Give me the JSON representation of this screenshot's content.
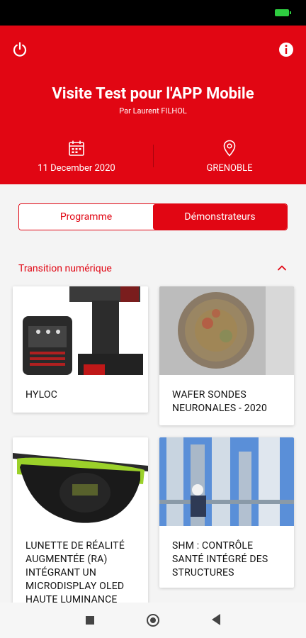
{
  "header": {
    "title": "Visite Test pour l'APP Mobile",
    "subtitle": "Par Laurent FILHOL",
    "date": "11 December 2020",
    "location": "GRENOBLE",
    "accent_color": "#e10613"
  },
  "tabs": [
    {
      "label": "Programme",
      "active": false
    },
    {
      "label": "Démonstrateurs",
      "active": true
    }
  ],
  "section": {
    "title": "Transition numérique",
    "expanded": true
  },
  "cards": [
    {
      "title": "HYLOC"
    },
    {
      "title": "WAFER SONDES NEURONALES - 2020"
    },
    {
      "title": "LUNETTE DE RÉALITÉ AUGMENTÉE (RA) INTÉGRANT UN MICRODISPLAY OLED HAUTE LUMINANCE"
    },
    {
      "title": "SHM : CONTRÔLE SANTÉ INTÉGRÉ DES STRUCTURES"
    }
  ],
  "icons": {
    "power": "power-icon",
    "info": "info-icon",
    "calendar": "calendar-icon",
    "location": "location-pin-icon",
    "chevron": "chevron-up-icon"
  }
}
